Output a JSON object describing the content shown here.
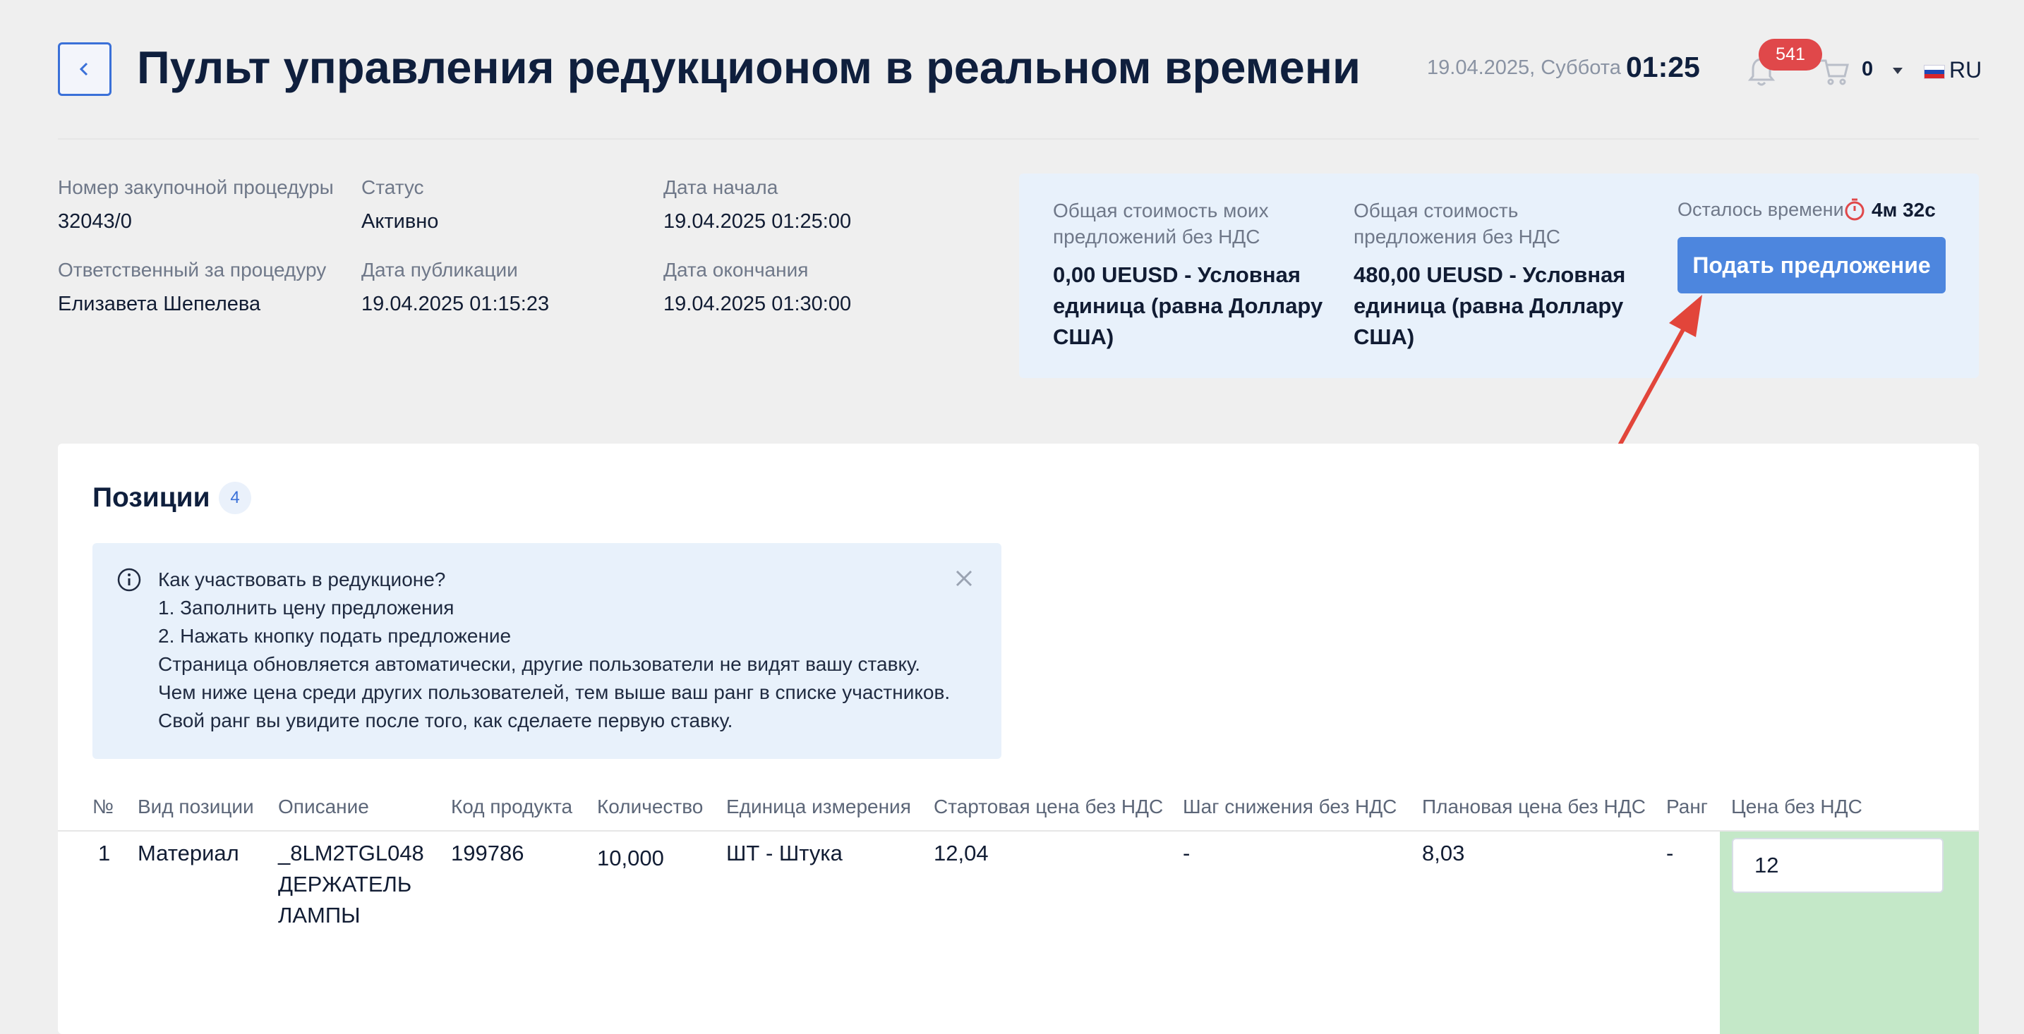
{
  "header": {
    "title": "Пульт управления редукционом в реальном времени",
    "date": "19.04.2025, Суббота",
    "time": "01:25",
    "notifications_count": "541",
    "cart_count": "0",
    "language": "RU",
    "icons": [
      "chevron-left-icon",
      "bell-icon",
      "cart-icon",
      "russia-flag-icon"
    ]
  },
  "procedure": {
    "number_label": "Номер закупочной процедуры",
    "number": "32043/0",
    "status_label": "Статус",
    "status": "Активно",
    "start_label": "Дата начала",
    "start": "19.04.2025 01:25:00",
    "responsible_label": "Ответственный за процедуру",
    "responsible": "Елизавета Шепелева",
    "published_label": "Дата публикации",
    "published": "19.04.2025 01:15:23",
    "end_label": "Дата окончания",
    "end": "19.04.2025 01:30:00"
  },
  "cost": {
    "my_label_1": "Общая стоимость моих",
    "my_label_2": "предложений без НДС",
    "my_value_1": "0,00 UEUSD - Условная",
    "my_value_2": "единица (равна Доллару",
    "my_value_3": "США)",
    "total_label_1": "Общая стоимость",
    "total_label_2": "предложения без НДС",
    "total_value_1": "480,00 UEUSD - Условная",
    "total_value_2": "единица (равна Доллару",
    "total_value_3": "США)",
    "time_left_label": "Осталось времени",
    "time_left": "4м 32с",
    "submit_label": "Подать предложение"
  },
  "positions": {
    "title": "Позиции",
    "count": "4",
    "hint": {
      "line1": "Как участвовать в редукционе?",
      "line2": "1. Заполнить цену предложения",
      "line3": "2. Нажать кнопку подать предложение",
      "line4": "Страница обновляется автоматически, другие пользователи не видят вашу ставку.",
      "line5": "Чем ниже цена среди других пользователей, тем выше ваш ранг в списке участников.",
      "line6": "Свой ранг вы увидите после того, как сделаете первую ставку."
    },
    "columns": [
      "№",
      "Вид позиции",
      "Описание",
      "Код продукта",
      "Количество",
      "Единица измерения",
      "Стартовая цена без НДС",
      "Шаг снижения без НДС",
      "Плановая цена без НДС",
      "Ранг",
      "Цена без НДС"
    ],
    "rows": [
      {
        "num": "1",
        "type": "Материал",
        "desc_1": "_8LM2TGL048",
        "desc_2": "ДЕРЖАТЕЛЬ",
        "desc_3": "ЛАМПЫ",
        "code": "199786",
        "qty": "10,000",
        "unit": "ШТ - Штука",
        "start_price": "12,04",
        "step": "-",
        "plan_price": "8,03",
        "rank": "-",
        "price": "12"
      }
    ]
  },
  "colors": {
    "accent": "#4d86de",
    "badge": "#e0484a",
    "panel": "#e8f1fb",
    "price_cell": "#c4e8c8",
    "annotation_arrow": "#e2453a"
  }
}
